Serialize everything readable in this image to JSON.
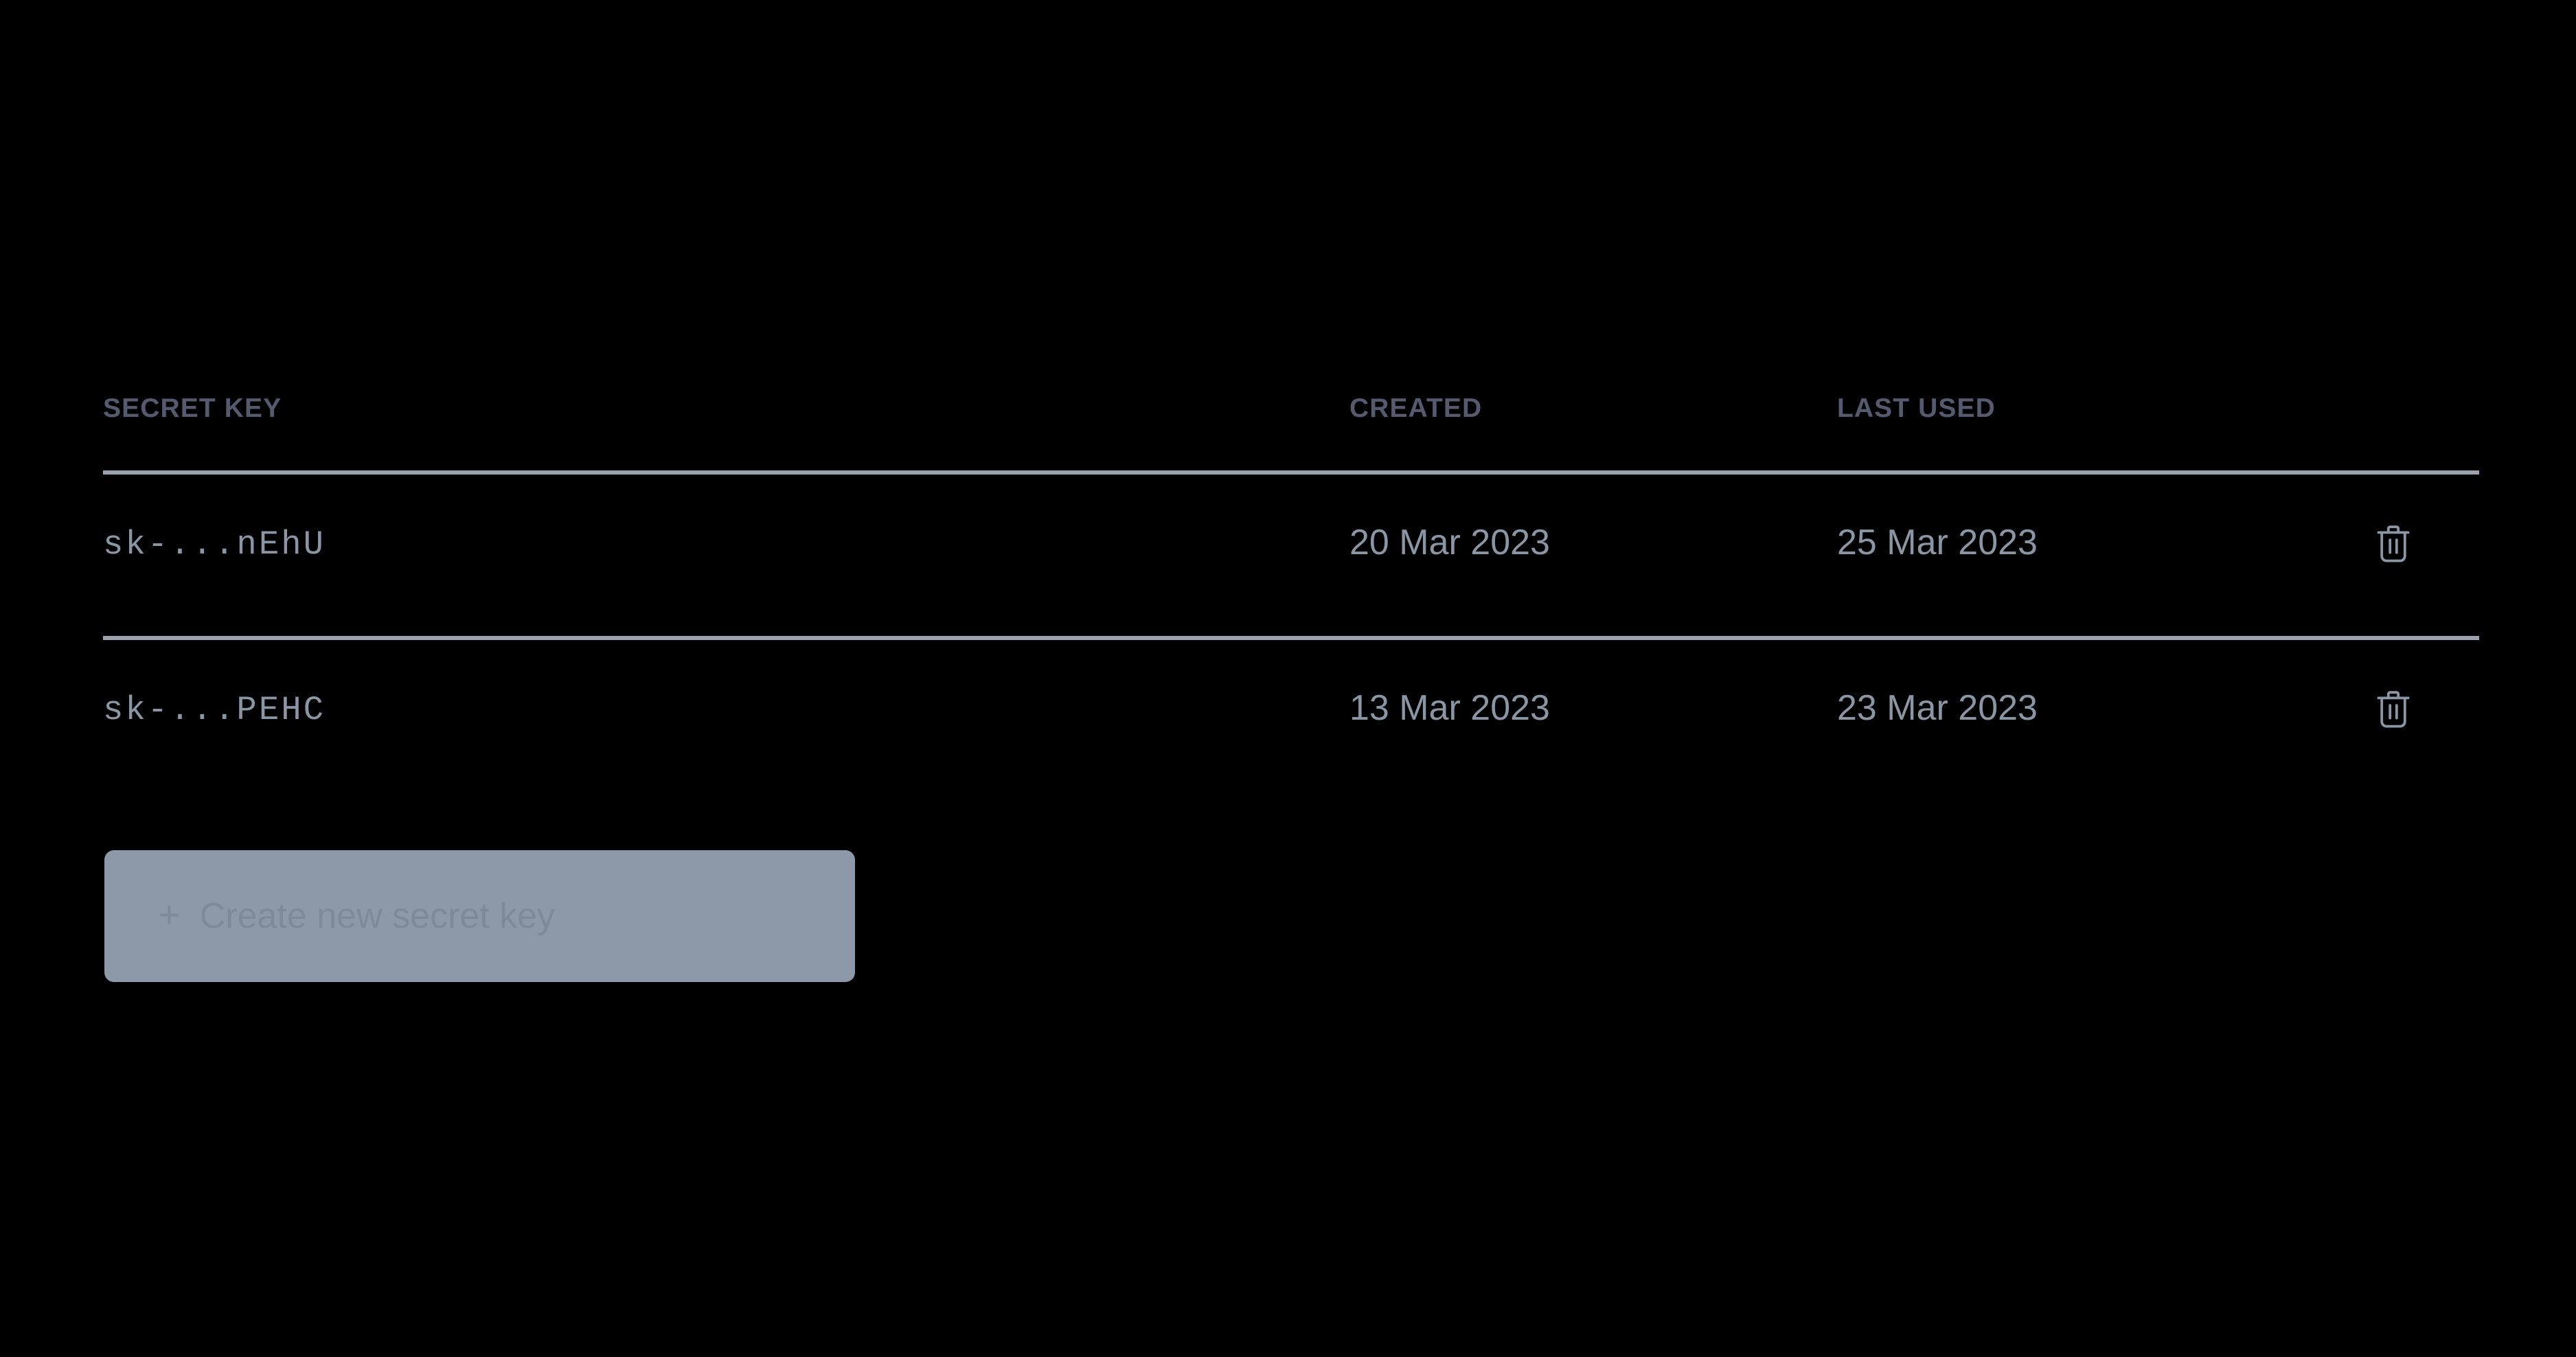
{
  "table": {
    "columns": [
      {
        "key": "secret_key",
        "label": "SECRET KEY"
      },
      {
        "key": "created",
        "label": "CREATED"
      },
      {
        "key": "last_used",
        "label": "LAST USED"
      }
    ],
    "rows": [
      {
        "secret_key": "sk-...nEhU",
        "created": "20 Mar 2023",
        "last_used": "25 Mar 2023",
        "delete_icon": "trash-icon"
      },
      {
        "secret_key": "sk-...PEHC",
        "created": "13 Mar 2023",
        "last_used": "23 Mar 2023",
        "delete_icon": "trash-icon"
      }
    ]
  },
  "create_button": {
    "plus_icon": "plus-icon",
    "label": "Create new secret key"
  },
  "colors": {
    "background": "#000000",
    "header_text": "#555a6e",
    "body_text": "#8b96a4",
    "divider": "#9aa3ad",
    "button_background": "#8d99a8",
    "button_text": "#7e8a99",
    "icon": "#8b96a4"
  }
}
